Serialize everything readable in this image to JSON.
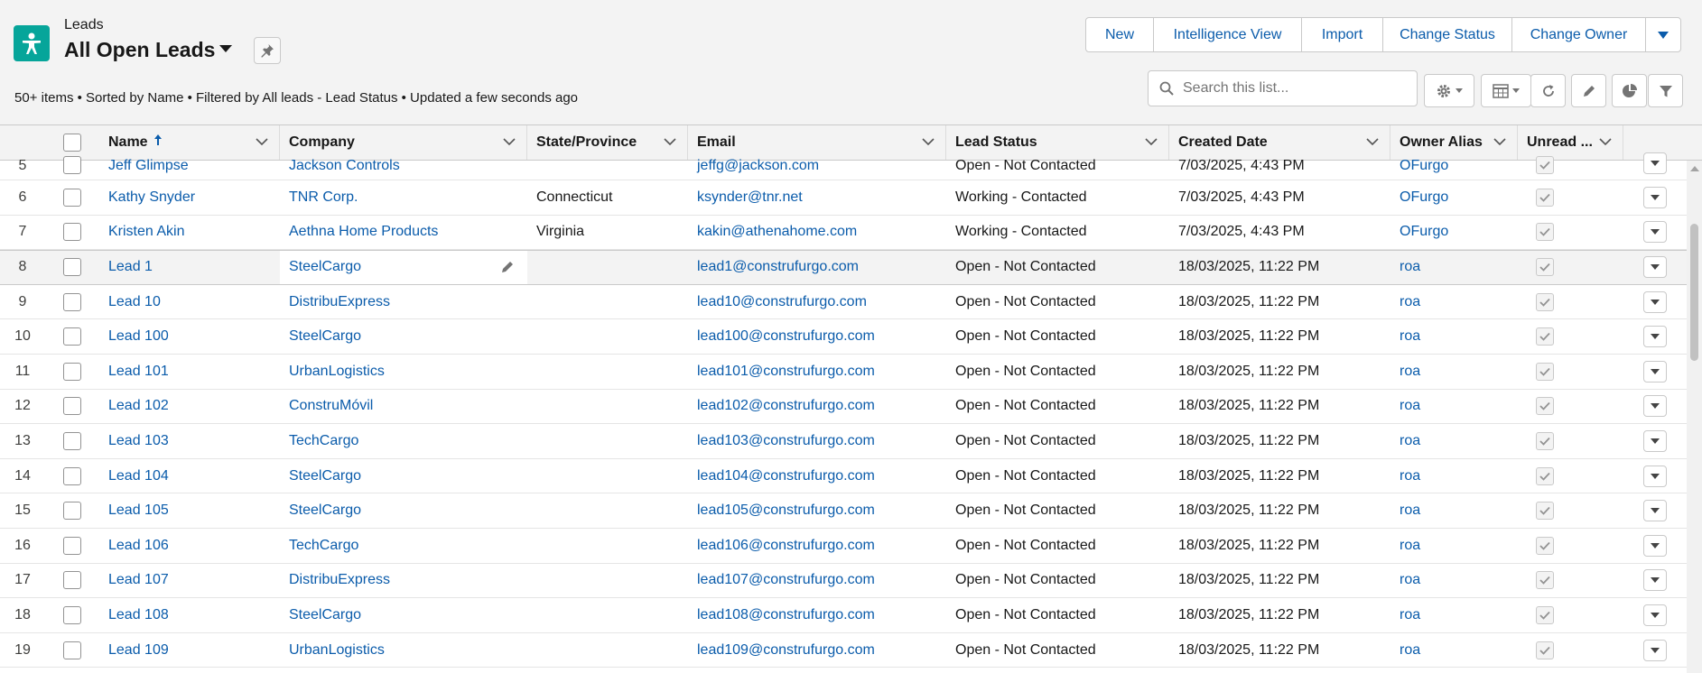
{
  "header": {
    "object_label": "Leads",
    "view_title": "All Open Leads",
    "meta_text": "50+ items • Sorted by Name • Filtered by All leads - Lead Status • Updated a few seconds ago",
    "accent_color": "#06a59a",
    "actions": {
      "new": "New",
      "intelligence_view": "Intelligence View",
      "import": "Import",
      "change_status": "Change Status",
      "change_owner": "Change Owner"
    },
    "search": {
      "placeholder": "Search this list...",
      "value": ""
    },
    "toolbar_icons": [
      "gear-icon",
      "table-view-icon",
      "refresh-icon",
      "pencil-icon",
      "pie-chart-icon",
      "filter-icon"
    ]
  },
  "table": {
    "columns": {
      "name": "Name",
      "company": "Company",
      "state": "State/Province",
      "email": "Email",
      "status": "Lead Status",
      "created": "Created Date",
      "owner": "Owner Alias",
      "unread": "Unread ..."
    },
    "sorted_by": "Name",
    "sort_direction": "ascending",
    "rows": [
      {
        "num": "5",
        "name": "Jeff Glimpse",
        "company": "Jackson Controls",
        "state": "",
        "email": "jeffg@jackson.com",
        "status": "Open - Not Contacted",
        "created": "7/03/2025, 4:43 PM",
        "owner": "OFurgo"
      },
      {
        "num": "6",
        "name": "Kathy Snyder",
        "company": "TNR Corp.",
        "state": "Connecticut",
        "email": "ksynder@tnr.net",
        "status": "Working - Contacted",
        "created": "7/03/2025, 4:43 PM",
        "owner": "OFurgo"
      },
      {
        "num": "7",
        "name": "Kristen Akin",
        "company": "Aethna Home Products",
        "state": "Virginia",
        "email": "kakin@athenahome.com",
        "status": "Working - Contacted",
        "created": "7/03/2025, 4:43 PM",
        "owner": "OFurgo"
      },
      {
        "num": "8",
        "name": "Lead 1",
        "company": "SteelCargo",
        "state": "",
        "email": "lead1@construfurgo.com",
        "status": "Open - Not Contacted",
        "created": "18/03/2025, 11:22 PM",
        "owner": "roa"
      },
      {
        "num": "9",
        "name": "Lead 10",
        "company": "DistribuExpress",
        "state": "",
        "email": "lead10@construfurgo.com",
        "status": "Open - Not Contacted",
        "created": "18/03/2025, 11:22 PM",
        "owner": "roa"
      },
      {
        "num": "10",
        "name": "Lead 100",
        "company": "SteelCargo",
        "state": "",
        "email": "lead100@construfurgo.com",
        "status": "Open - Not Contacted",
        "created": "18/03/2025, 11:22 PM",
        "owner": "roa"
      },
      {
        "num": "11",
        "name": "Lead 101",
        "company": "UrbanLogistics",
        "state": "",
        "email": "lead101@construfurgo.com",
        "status": "Open - Not Contacted",
        "created": "18/03/2025, 11:22 PM",
        "owner": "roa"
      },
      {
        "num": "12",
        "name": "Lead 102",
        "company": "ConstruMóvil",
        "state": "",
        "email": "lead102@construfurgo.com",
        "status": "Open - Not Contacted",
        "created": "18/03/2025, 11:22 PM",
        "owner": "roa"
      },
      {
        "num": "13",
        "name": "Lead 103",
        "company": "TechCargo",
        "state": "",
        "email": "lead103@construfurgo.com",
        "status": "Open - Not Contacted",
        "created": "18/03/2025, 11:22 PM",
        "owner": "roa"
      },
      {
        "num": "14",
        "name": "Lead 104",
        "company": "SteelCargo",
        "state": "",
        "email": "lead104@construfurgo.com",
        "status": "Open - Not Contacted",
        "created": "18/03/2025, 11:22 PM",
        "owner": "roa"
      },
      {
        "num": "15",
        "name": "Lead 105",
        "company": "SteelCargo",
        "state": "",
        "email": "lead105@construfurgo.com",
        "status": "Open - Not Contacted",
        "created": "18/03/2025, 11:22 PM",
        "owner": "roa"
      },
      {
        "num": "16",
        "name": "Lead 106",
        "company": "TechCargo",
        "state": "",
        "email": "lead106@construfurgo.com",
        "status": "Open - Not Contacted",
        "created": "18/03/2025, 11:22 PM",
        "owner": "roa"
      },
      {
        "num": "17",
        "name": "Lead 107",
        "company": "DistribuExpress",
        "state": "",
        "email": "lead107@construfurgo.com",
        "status": "Open - Not Contacted",
        "created": "18/03/2025, 11:22 PM",
        "owner": "roa"
      },
      {
        "num": "18",
        "name": "Lead 108",
        "company": "SteelCargo",
        "state": "",
        "email": "lead108@construfurgo.com",
        "status": "Open - Not Contacted",
        "created": "18/03/2025, 11:22 PM",
        "owner": "roa"
      },
      {
        "num": "19",
        "name": "Lead 109",
        "company": "UrbanLogistics",
        "state": "",
        "email": "lead109@construfurgo.com",
        "status": "Open - Not Contacted",
        "created": "18/03/2025, 11:22 PM",
        "owner": "roa"
      }
    ]
  }
}
